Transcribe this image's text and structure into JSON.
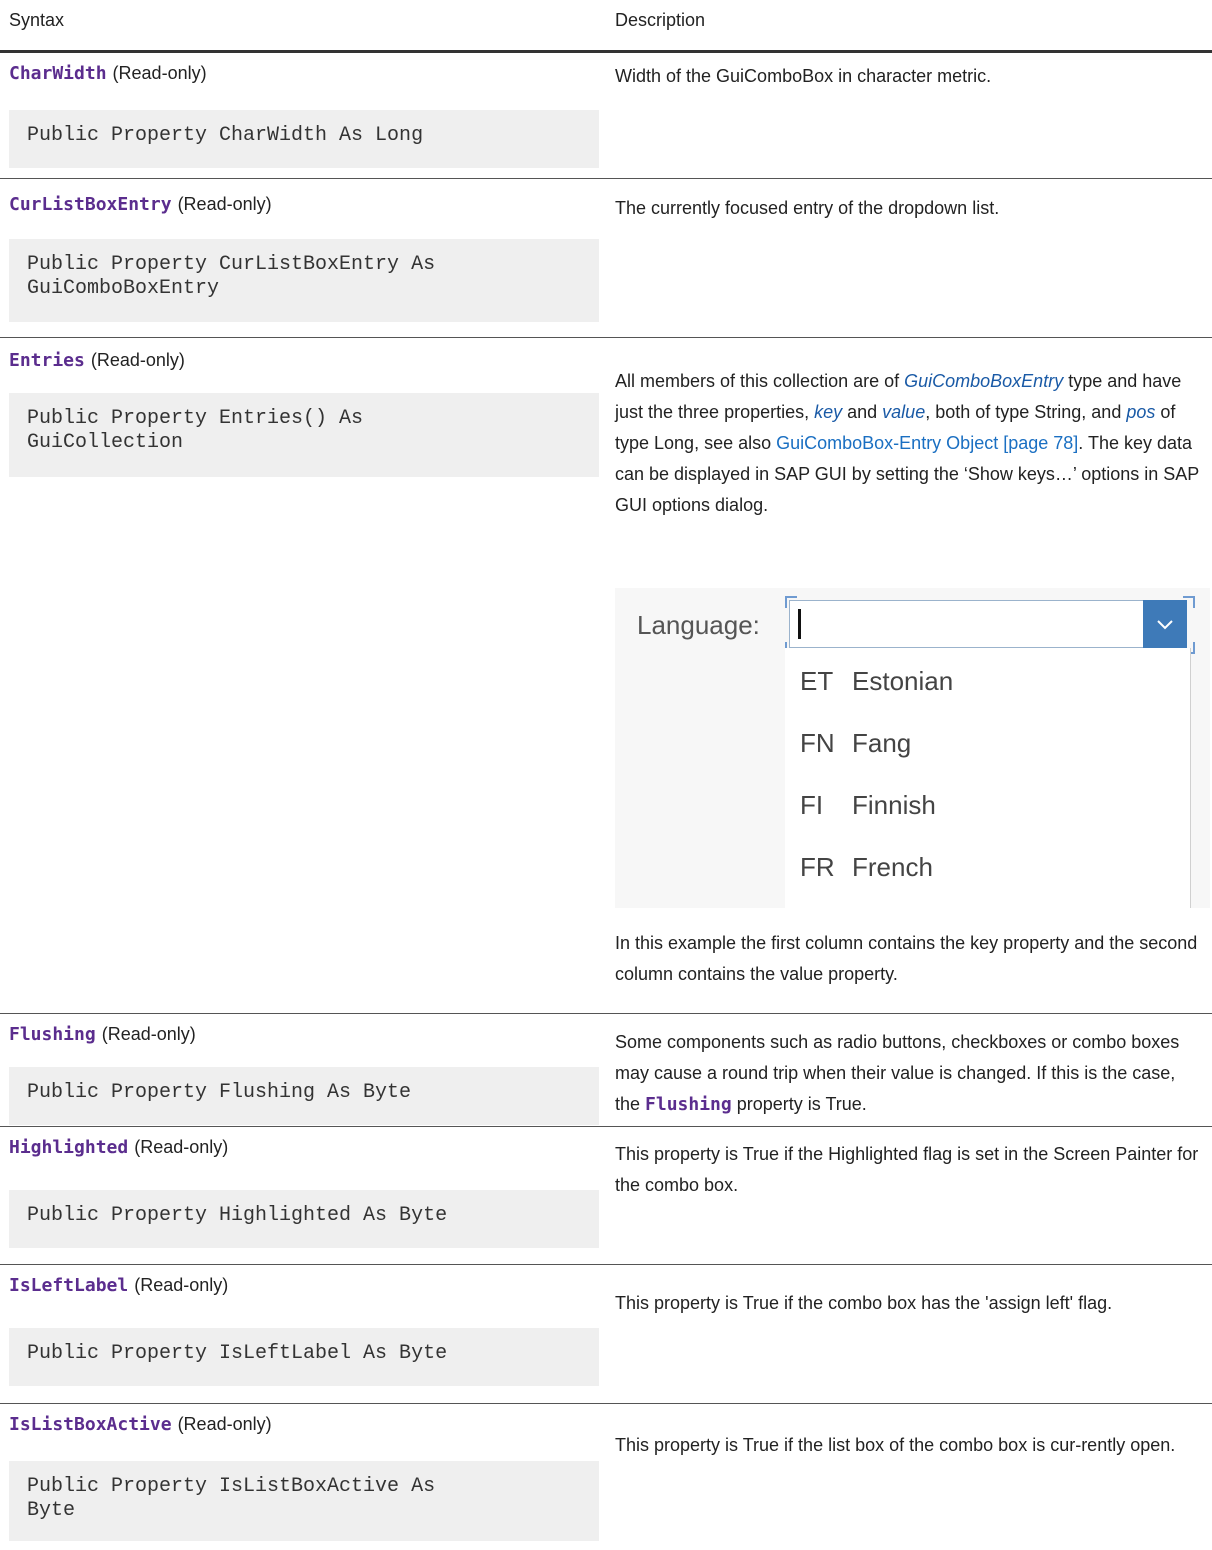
{
  "header": {
    "syntax": "Syntax",
    "description": "Description"
  },
  "rows": [
    {
      "name": "CharWidth",
      "access": "(Read-only)",
      "code": "Public Property CharWidth As Long",
      "desc": "Width of the GuiComboBox in character metric."
    },
    {
      "name": "CurListBoxEntry",
      "access": "(Read-only)",
      "code": "Public Property CurListBoxEntry As\nGuiComboBoxEntry",
      "desc": "The currently focused entry of the dropdown list."
    },
    {
      "name": "Entries",
      "access": "(Read-only)",
      "code": "Public Property Entries() As\nGuiCollection",
      "desc_parts": {
        "p1": "All members of this collection are of ",
        "it1": "GuiComboBoxEntry",
        "p2": " type and have just the three properties, ",
        "it2": "key",
        "p3": " and ",
        "it3": "value",
        "p4": ", both of type String, and ",
        "it4": "pos",
        "p5": " of type Long, see also ",
        "link": "GuiComboBox-Entry Object [page 78]",
        "p6": ". The key data can be displayed in SAP GUI by setting the ‘Show keys…’ options in SAP GUI options dialog."
      },
      "desc_after": "In this example the first column contains the key property and the second column contains the value property."
    },
    {
      "name": "Flushing",
      "access": "(Read-only)",
      "code": "Public Property Flushing As Byte",
      "desc_parts": {
        "p1": "Some components such as radio buttons, checkboxes or combo boxes may cause a round trip when their value is changed. If this is the case, the ",
        "mono": "Flushing",
        "p2": " property is True."
      }
    },
    {
      "name": "Highlighted",
      "access": "(Read-only)",
      "code": "Public Property Highlighted As Byte",
      "desc": "This property is True if the Highlighted flag is set in the Screen Painter for the combo box."
    },
    {
      "name": "IsLeftLabel",
      "access": "(Read-only)",
      "code": "Public Property IsLeftLabel As Byte",
      "desc": "This property is True if the combo box has the 'assign left' flag."
    },
    {
      "name": "IsListBoxActive",
      "access": "(Read-only)",
      "code": "Public Property IsListBoxActive As\nByte",
      "desc": "This property is True if the list box of the combo box is cur-rently open."
    }
  ],
  "example": {
    "label": "Language:",
    "entries": [
      {
        "key": "ET",
        "value": "Estonian"
      },
      {
        "key": "FN",
        "value": "Fang"
      },
      {
        "key": "FI",
        "value": "Finnish"
      },
      {
        "key": "FR",
        "value": "French"
      }
    ],
    "colors": {
      "accent": "#3e7ab8",
      "property_name": "#5b2d8e",
      "link": "#1a6fc2"
    }
  }
}
